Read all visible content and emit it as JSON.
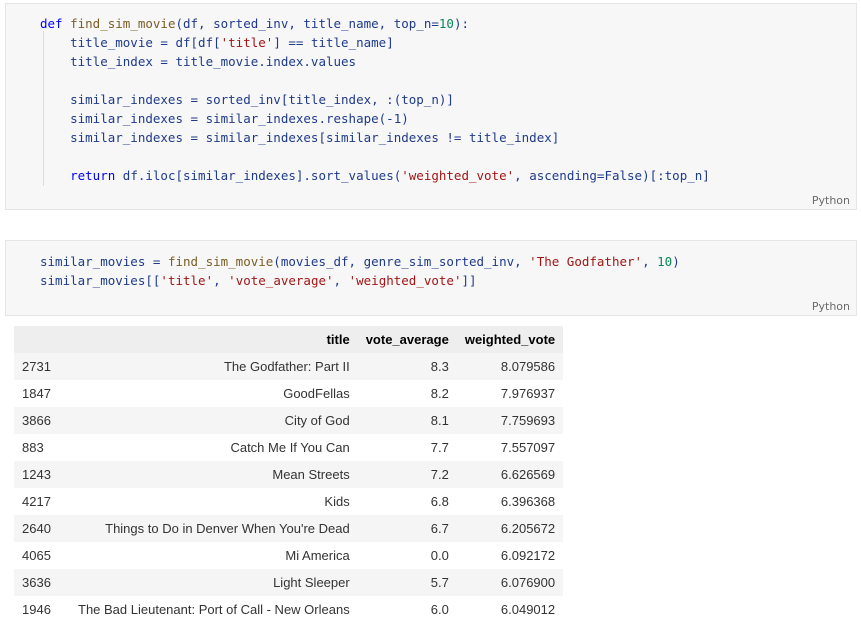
{
  "cells": [
    {
      "language": "Python",
      "lines": [
        [
          {
            "t": "def",
            "c": "kw"
          },
          {
            "t": " "
          },
          {
            "t": "find_sim_movie",
            "c": "fn"
          },
          {
            "t": "(df, sorted_inv, title_name, top_n="
          },
          {
            "t": "10",
            "c": "nu"
          },
          {
            "t": "):"
          }
        ],
        [
          {
            "t": "    title_movie = df[df["
          },
          {
            "t": "'title'",
            "c": "st"
          },
          {
            "t": "] == title_name]"
          }
        ],
        [
          {
            "t": "    title_index = title_movie.index.values"
          }
        ],
        [
          {
            "t": ""
          }
        ],
        [
          {
            "t": "    similar_indexes = sorted_inv[title_index, :(top_n)]"
          }
        ],
        [
          {
            "t": "    similar_indexes = similar_indexes.reshape(-1)"
          }
        ],
        [
          {
            "t": "    similar_indexes = similar_indexes[similar_indexes != title_index]"
          }
        ],
        [
          {
            "t": ""
          }
        ],
        [
          {
            "t": "    "
          },
          {
            "t": "return",
            "c": "kw"
          },
          {
            "t": " df.iloc[similar_indexes].sort_values("
          },
          {
            "t": "'weighted_vote'",
            "c": "st"
          },
          {
            "t": ", ascending=False)[:top_n]"
          }
        ]
      ]
    },
    {
      "language": "Python",
      "lines": [
        [
          {
            "t": "similar_movies = "
          },
          {
            "t": "find_sim_movie",
            "c": "fn"
          },
          {
            "t": "(movies_df, genre_sim_sorted_inv, "
          },
          {
            "t": "'The Godfather'",
            "c": "st"
          },
          {
            "t": ", "
          },
          {
            "t": "10",
            "c": "nu"
          },
          {
            "t": ")"
          }
        ],
        [
          {
            "t": "similar_movies[["
          },
          {
            "t": "'title'",
            "c": "st"
          },
          {
            "t": ", "
          },
          {
            "t": "'vote_average'",
            "c": "st"
          },
          {
            "t": ", "
          },
          {
            "t": "'weighted_vote'",
            "c": "st"
          },
          {
            "t": "]]"
          }
        ]
      ]
    }
  ],
  "output_table": {
    "columns": [
      "",
      "title",
      "vote_average",
      "weighted_vote"
    ],
    "rows": [
      [
        "2731",
        "The Godfather: Part II",
        "8.3",
        "8.079586"
      ],
      [
        "1847",
        "GoodFellas",
        "8.2",
        "7.976937"
      ],
      [
        "3866",
        "City of God",
        "8.1",
        "7.759693"
      ],
      [
        "883",
        "Catch Me If You Can",
        "7.7",
        "7.557097"
      ],
      [
        "1243",
        "Mean Streets",
        "7.2",
        "6.626569"
      ],
      [
        "4217",
        "Kids",
        "6.8",
        "6.396368"
      ],
      [
        "2640",
        "Things to Do in Denver When You're Dead",
        "6.7",
        "6.205672"
      ],
      [
        "4065",
        "Mi America",
        "0.0",
        "6.092172"
      ],
      [
        "3636",
        "Light Sleeper",
        "5.7",
        "6.076900"
      ],
      [
        "1946",
        "The Bad Lieutenant: Port of Call - New Orleans",
        "6.0",
        "6.049012"
      ]
    ]
  }
}
